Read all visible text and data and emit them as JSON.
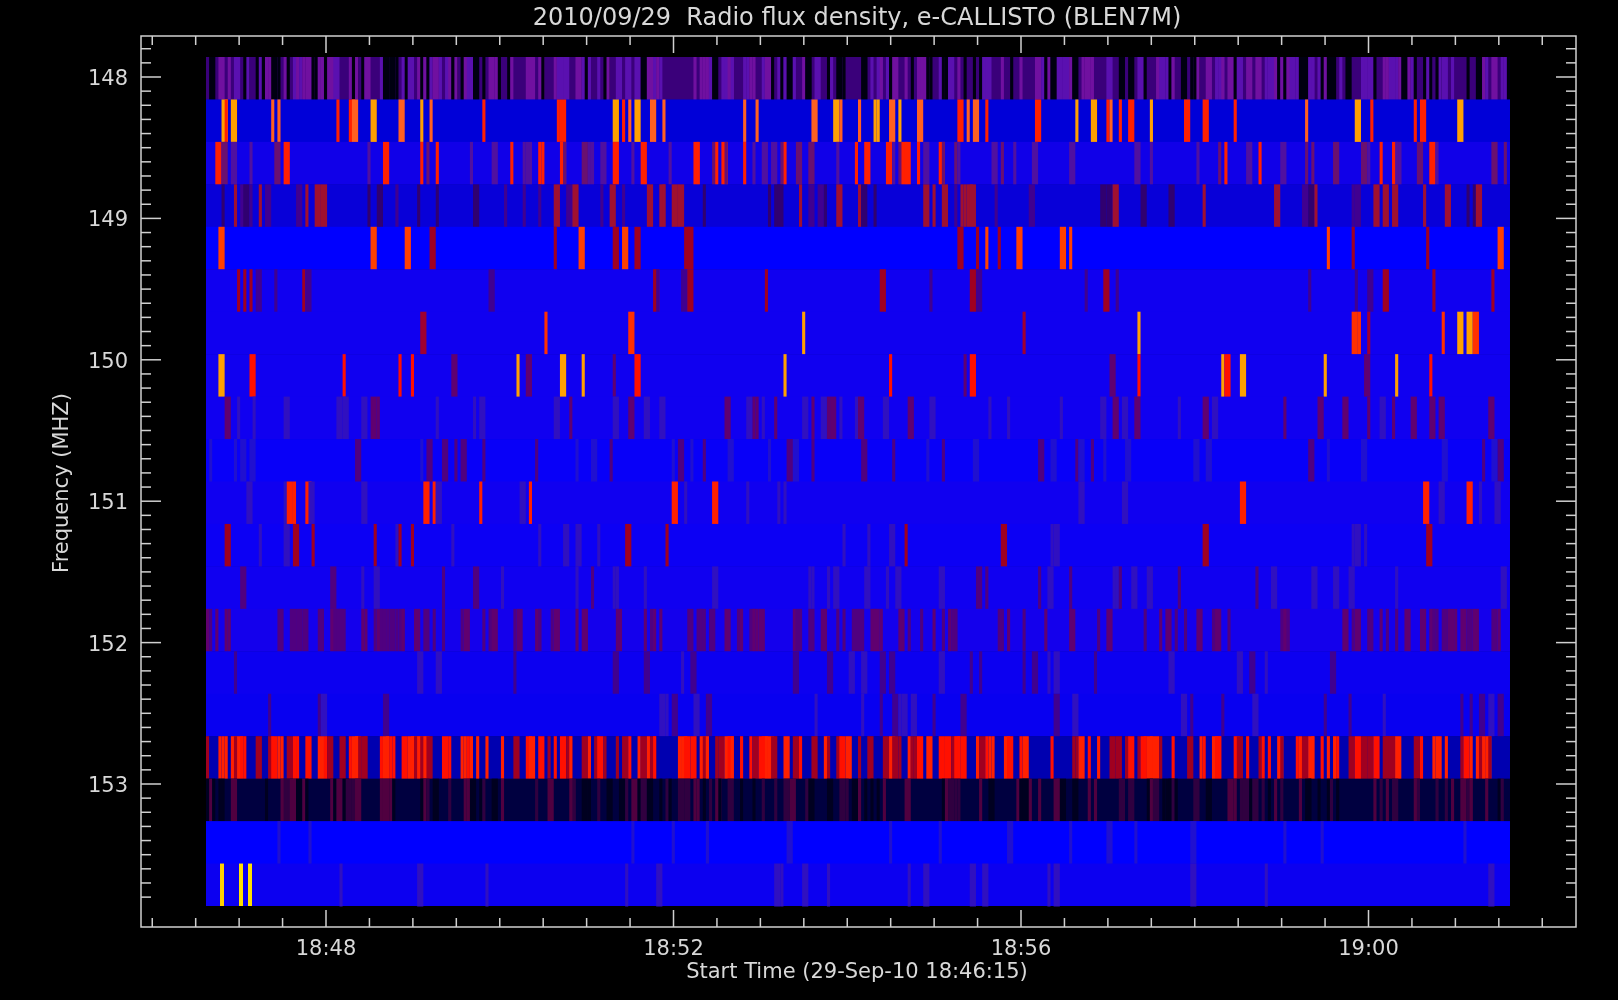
{
  "plot": {
    "title": "2010/09/29  Radio flux density, e-CALLISTO (BLEN7M)",
    "ylabel": "Frequency (MHZ)",
    "xlabel": "Start Time (29-Sep-10 18:46:15)",
    "yticks": [
      "148",
      "149",
      "150",
      "151",
      "152",
      "153"
    ],
    "xticks": [
      "18:48",
      "18:52",
      "18:56",
      "19:00"
    ]
  }
}
